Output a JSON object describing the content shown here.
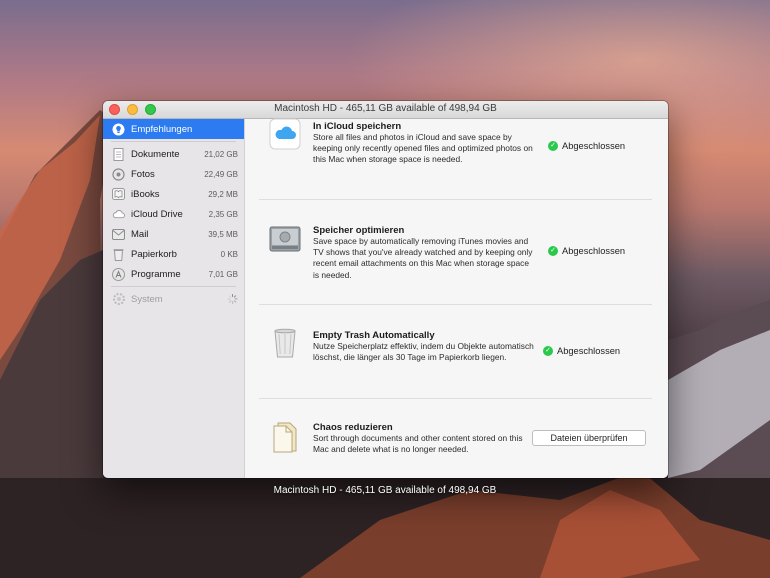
{
  "window": {
    "title": "Macintosh HD - 465,11 GB available of 498,94 GB"
  },
  "caption": "Macintosh HD - 465,11 GB available of 498,94 GB",
  "sidebar": {
    "items": [
      {
        "label": "Empfehlungen",
        "size": "",
        "icon": "lightbulb-icon"
      },
      {
        "label": "Dokumente",
        "size": "21,02 GB",
        "icon": "document-icon"
      },
      {
        "label": "Fotos",
        "size": "22,49 GB",
        "icon": "photos-icon"
      },
      {
        "label": "iBooks",
        "size": "29,2 MB",
        "icon": "book-icon"
      },
      {
        "label": "iCloud Drive",
        "size": "2,35 GB",
        "icon": "cloud-icon"
      },
      {
        "label": "Mail",
        "size": "39,5 MB",
        "icon": "mail-icon"
      },
      {
        "label": "Papierkorb",
        "size": "0 KB",
        "icon": "trash-icon"
      },
      {
        "label": "Programme",
        "size": "7,01 GB",
        "icon": "apps-icon"
      },
      {
        "label": "System",
        "size": "",
        "icon": "gear-icon"
      }
    ]
  },
  "recommendations": [
    {
      "title": "In iCloud speichern",
      "description": "Store all files and photos in iCloud and save space by keeping only recently opened files and optimized photos on this Mac when storage space is needed.",
      "status": "Abgeschlossen",
      "icon": "icloud-icon"
    },
    {
      "title": "Speicher optimieren",
      "description": "Save space by automatically removing iTunes movies and TV shows that you've already watched and by keeping only recent email attachments on this Mac when storage space is needed.",
      "status": "Abgeschlossen",
      "icon": "hard-drive-icon"
    },
    {
      "title": "Empty Trash Automatically",
      "description": "Nutze Speicherplatz effektiv, indem du Objekte automatisch löschst, die länger als 30 Tage im Papierkorb liegen.",
      "status": "Abgeschlossen",
      "icon": "trash-can-icon"
    },
    {
      "title": "Chaos reduzieren",
      "description": "Sort through documents and other content stored on this Mac and delete what is no longer needed.",
      "button": "Dateien überprüfen",
      "icon": "documents-icon"
    }
  ],
  "colors": {
    "selection": "#2c7bf0",
    "check": "#2ac94b"
  }
}
